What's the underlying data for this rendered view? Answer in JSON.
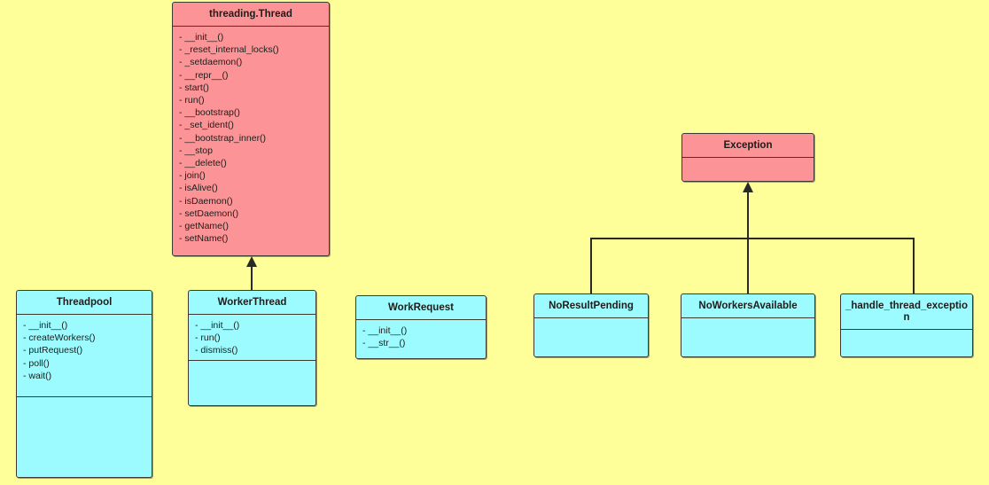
{
  "diagram": {
    "kind": "uml-class-diagram",
    "background_color": "#ffff99",
    "class_fill_pink": "#fc9396",
    "class_fill_cyan": "#9bfbff",
    "border_color": "#3a3a32",
    "connector_color": "#2a2a24"
  },
  "classes": {
    "threading_thread": {
      "name": "threading.Thread",
      "members": [
        "- __init__()",
        "- _reset_internal_locks()",
        "- _setdaemon()",
        "- __repr__()",
        "- start()",
        "- run()",
        "- __bootstrap()",
        "- _set_ident()",
        "- __bootstrap_inner()",
        "- __stop",
        "- __delete()",
        "- join()",
        "- isAlive()",
        "- isDaemon()",
        "- setDaemon()",
        "- getName()",
        "- setName()"
      ]
    },
    "threadpool": {
      "name": "Threadpool",
      "members": [
        "- __init__()",
        "- createWorkers()",
        "- putRequest()",
        "- poll()",
        "- wait()"
      ]
    },
    "workerthread": {
      "name": "WorkerThread",
      "members": [
        "- __init__()",
        "- run()",
        "- dismiss()"
      ]
    },
    "workrequest": {
      "name": "WorkRequest",
      "members": [
        "- __init__()",
        "- __str__()"
      ]
    },
    "exception": {
      "name": "Exception",
      "members": []
    },
    "noresultpending": {
      "name": "NoResultPending",
      "members": []
    },
    "noworkersavailable": {
      "name": "NoWorkersAvailable",
      "members": []
    },
    "handle_thread_exception": {
      "name": "_handle_thread_exception",
      "members": []
    }
  }
}
